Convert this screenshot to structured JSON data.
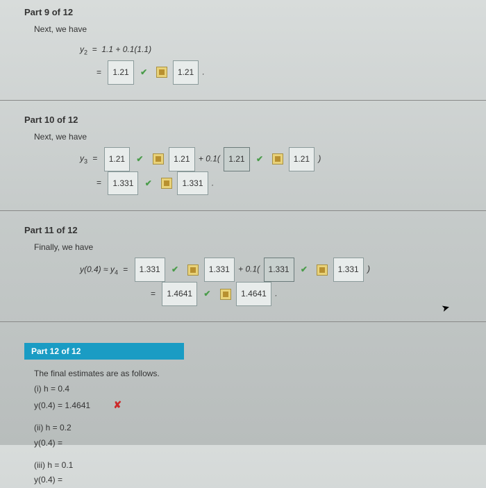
{
  "part9": {
    "header": "Part 9 of 12",
    "intro": "Next, we have",
    "line1": "y2  =  1.1 + 0.1(1.1)",
    "eq": "=",
    "ans1_input": "1.21",
    "ans1_reveal": "1.21",
    "period": "."
  },
  "part10": {
    "header": "Part 10 of 12",
    "intro": "Next, we have",
    "y3": "y3",
    "eq": "=",
    "v1": "1.21",
    "v1r": "1.21",
    "plus01": " + 0.1(",
    "v2": "1.21",
    "v2r": "1.21",
    "close": " )",
    "line2eq": "=",
    "v3": "1.331",
    "v3r": "1.331",
    "period": "."
  },
  "part11": {
    "header": "Part 11 of 12",
    "intro": "Finally, we have",
    "lhs": "y(0.4) ≈ y4",
    "eq": "=",
    "v1": "1.331",
    "v1r": "1.331",
    "plus01": " + 0.1(",
    "v2": "1.331",
    "v2r": "1.331",
    "close": " )",
    "line2eq": "=",
    "v3": "1.4641",
    "v3r": "1.4641",
    "period": "."
  },
  "part12": {
    "tab": "Part 12 of 12",
    "intro": "The final estimates are as follows.",
    "i_h": "(i) h = 0.4",
    "i_y": "y(0.4) =  1.4641",
    "ii_h": "(ii) h = 0.2",
    "ii_y": "y(0.4) =",
    "iii_h": "(iii) h = 0.1",
    "iii_y": "y(0.4) ="
  }
}
